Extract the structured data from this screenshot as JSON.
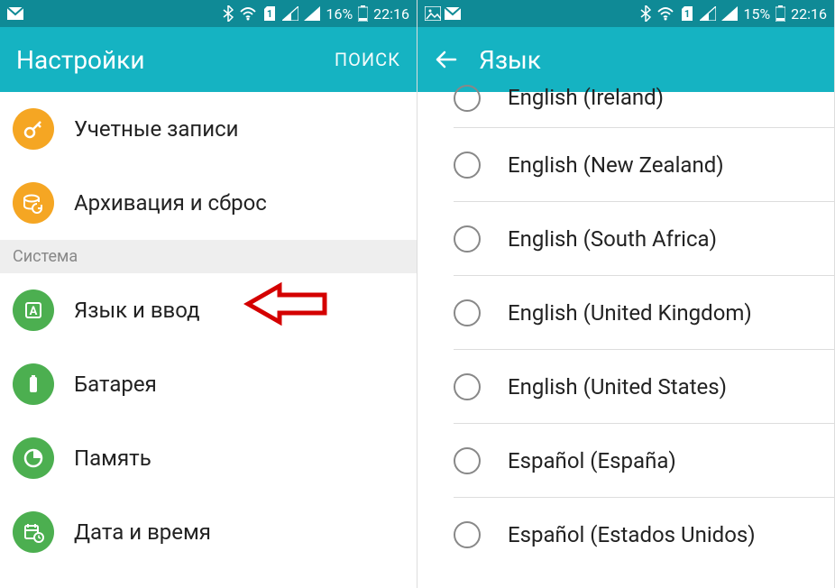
{
  "left": {
    "status": {
      "battery_pct": "16%",
      "time": "22:16"
    },
    "appbar": {
      "title": "Настройки",
      "search_label": "ПОИСК"
    },
    "items_top": [
      {
        "label": "Учетные записи",
        "icon": "key-icon",
        "color": "orange"
      },
      {
        "label": "Архивация и сброс",
        "icon": "backup-icon",
        "color": "orange"
      }
    ],
    "section_header": "Система",
    "items_system": [
      {
        "label": "Язык и ввод",
        "icon": "language-icon",
        "color": "green",
        "highlight": true
      },
      {
        "label": "Батарея",
        "icon": "battery-icon",
        "color": "green"
      },
      {
        "label": "Память",
        "icon": "memory-icon",
        "color": "green"
      },
      {
        "label": "Дата и время",
        "icon": "date-time-icon",
        "color": "green"
      }
    ]
  },
  "right": {
    "status": {
      "battery_pct": "15%",
      "time": "22:16"
    },
    "appbar": {
      "title": "Язык"
    },
    "languages": [
      "English (Ireland)",
      "English (New Zealand)",
      "English (South Africa)",
      "English (United Kingdom)",
      "English (United States)",
      "Español (España)",
      "Español (Estados Unidos)"
    ]
  }
}
